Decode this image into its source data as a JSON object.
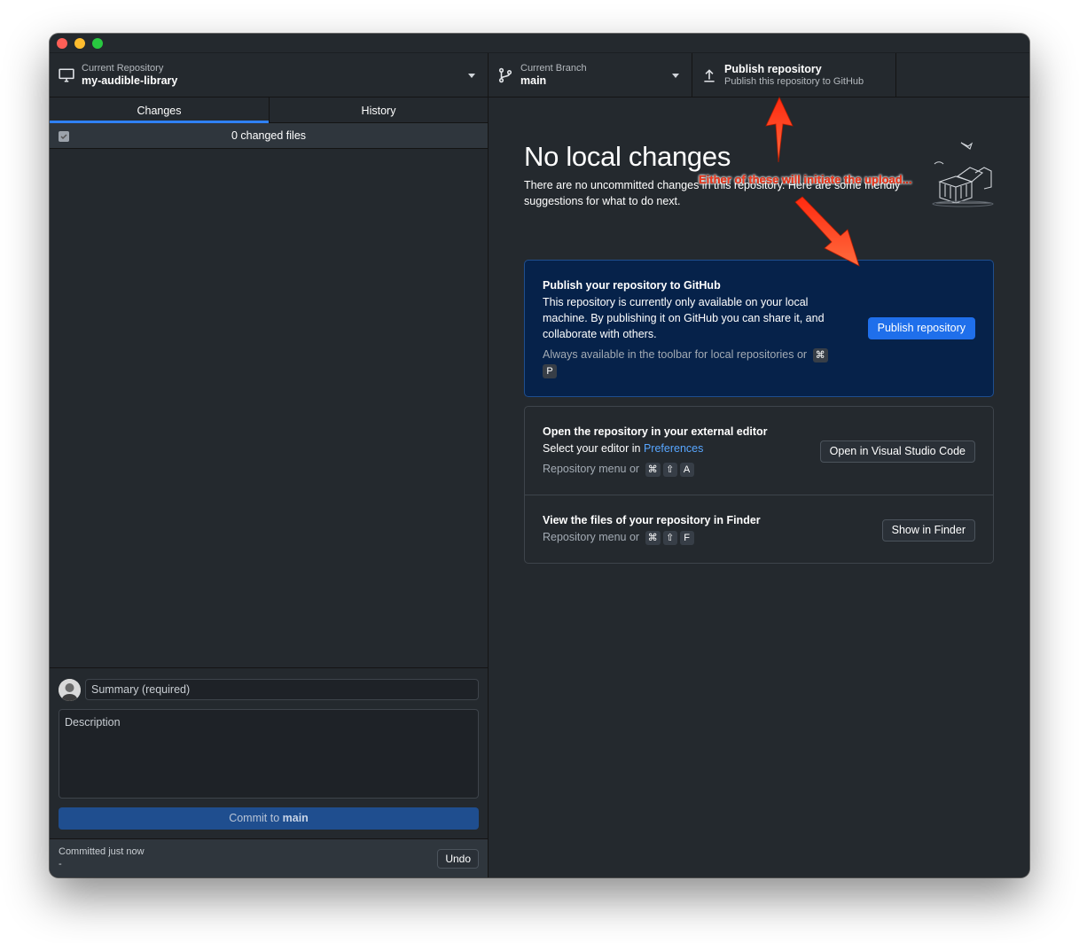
{
  "toolbar": {
    "repo": {
      "label": "Current Repository",
      "value": "my-audible-library"
    },
    "branch": {
      "label": "Current Branch",
      "value": "main"
    },
    "publish": {
      "label": "Publish repository",
      "value": "Publish this repository to GitHub"
    }
  },
  "sidebar": {
    "tabs": [
      {
        "label": "Changes"
      },
      {
        "label": "History"
      }
    ],
    "changed_files": "0 changed files",
    "commit": {
      "summary_placeholder": "Summary (required)",
      "description_placeholder": "Description",
      "button_prefix": "Commit to ",
      "button_branch": "main"
    },
    "last_commit": {
      "time": "Committed just now",
      "dash": "-",
      "undo_label": "Undo"
    }
  },
  "main": {
    "title": "No local changes",
    "subtitle_line1": "There are no uncommitted changes in this repository. Here are some friendly",
    "subtitle_line2": "suggestions for what to do next.",
    "publish_card": {
      "title": "Publish your repository to GitHub",
      "text_line1": "This repository is currently only available on your local",
      "text_line2": "machine. By publishing it on GitHub you can share it, and",
      "text_line3": "collaborate with others.",
      "hint": "Always available in the toolbar for local repositories or",
      "shortcut_1": "⌘",
      "shortcut_2": "P",
      "button": "Publish repository"
    },
    "editor_card": {
      "title": "Open the repository in your external editor",
      "text_prefix": "Select your editor in ",
      "text_link": "Preferences",
      "hint": "Repository menu or",
      "shortcut_1": "⌘",
      "shortcut_2": "⇧",
      "shortcut_3": "A",
      "button": "Open in Visual Studio Code"
    },
    "finder_card": {
      "title": "View the files of your repository in Finder",
      "hint": "Repository menu or",
      "shortcut_1": "⌘",
      "shortcut_2": "⇧",
      "shortcut_3": "F",
      "button": "Show in Finder"
    }
  },
  "annotation": {
    "text": "Either of these will initiate the upload...",
    "color": "#ff3b1f"
  },
  "icons": {
    "repo": "desktop-computer-icon",
    "branch": "git-branch-icon",
    "publish": "upload-arrow-icon"
  }
}
